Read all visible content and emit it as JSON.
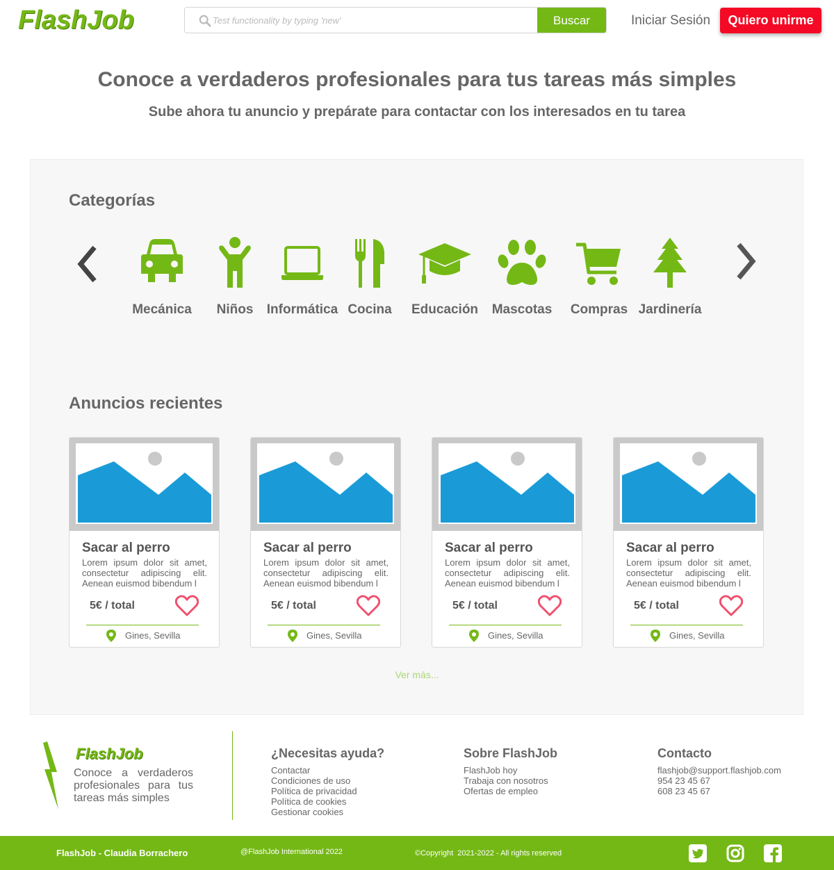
{
  "header": {
    "logo": "FlashJob",
    "search_placeholder": "Test functionality by typing 'new'",
    "search_button": "Buscar",
    "login": "Iniciar Sesión",
    "join": "Quiero unirme"
  },
  "hero": {
    "title": "Conoce a verdaderos profesionales para tus tareas más simples",
    "subtitle": "Sube ahora tu anuncio y prepárate para contactar con los interesados en tu tarea"
  },
  "categories": {
    "title": "Categorías",
    "items": [
      {
        "label": "Mecánica",
        "icon": "car-icon"
      },
      {
        "label": "Niños",
        "icon": "child-icon"
      },
      {
        "label": "Informática",
        "icon": "laptop-icon"
      },
      {
        "label": "Cocina",
        "icon": "cutlery-icon"
      },
      {
        "label": "Educación",
        "icon": "graduation-cap-icon"
      },
      {
        "label": "Mascotas",
        "icon": "paw-icon"
      },
      {
        "label": "Compras",
        "icon": "shopping-cart-icon"
      },
      {
        "label": "Jardinería",
        "icon": "tree-icon"
      }
    ]
  },
  "ads": {
    "title": "Anuncios recientes",
    "items": [
      {
        "title": "Sacar al perro",
        "desc": "Lorem ipsum dolor sit amet, consectetur adipiscing elit. Aenean euismod bibendum l",
        "price": "5€ / total",
        "location": "Gines, Sevilla"
      },
      {
        "title": "Sacar al perro",
        "desc": "Lorem ipsum dolor sit amet, consectetur adipiscing elit. Aenean euismod bibendum l",
        "price": "5€ / total",
        "location": "Gines, Sevilla"
      },
      {
        "title": "Sacar al perro",
        "desc": "Lorem ipsum dolor sit amet, consectetur adipiscing elit. Aenean euismod bibendum l",
        "price": "5€ / total",
        "location": "Gines, Sevilla"
      },
      {
        "title": "Sacar al perro",
        "desc": "Lorem ipsum dolor sit amet, consectetur adipiscing elit. Aenean euismod bibendum l",
        "price": "5€ / total",
        "location": "Gines, Sevilla"
      }
    ],
    "more": "Ver más..."
  },
  "footer": {
    "logo": "FlashJob",
    "tagline": "Conoce a verdaderos profesionales para tus tareas más simples",
    "help": {
      "title": "¿Necesitas ayuda?",
      "links": [
        "Contactar",
        "Condiciones de uso",
        "Política de privacidad",
        "Política de cookies",
        "Gestionar cookies"
      ]
    },
    "about": {
      "title": "Sobre FlashJob",
      "links": [
        "FlashJob hoy",
        "Trabaja con nosotros",
        "Ofertas de empleo"
      ]
    },
    "contact": {
      "title": "Contacto",
      "lines": [
        "flashjob@support.flashjob.com",
        "954 23 45 67",
        "608 23 45 67"
      ]
    }
  },
  "bottom_bar": {
    "author": "FlashJob - Claudia Borrachero",
    "company": "@FlashJob International 2022",
    "copyright": "©Copyright  2021-2022 - All rights reserved",
    "social": [
      "twitter-icon",
      "instagram-icon",
      "facebook-icon"
    ]
  },
  "colors": {
    "brand_green": "#74b816",
    "join_red": "#f50a25",
    "image_blue": "#1a9bd7",
    "heart": "#f0506e"
  }
}
